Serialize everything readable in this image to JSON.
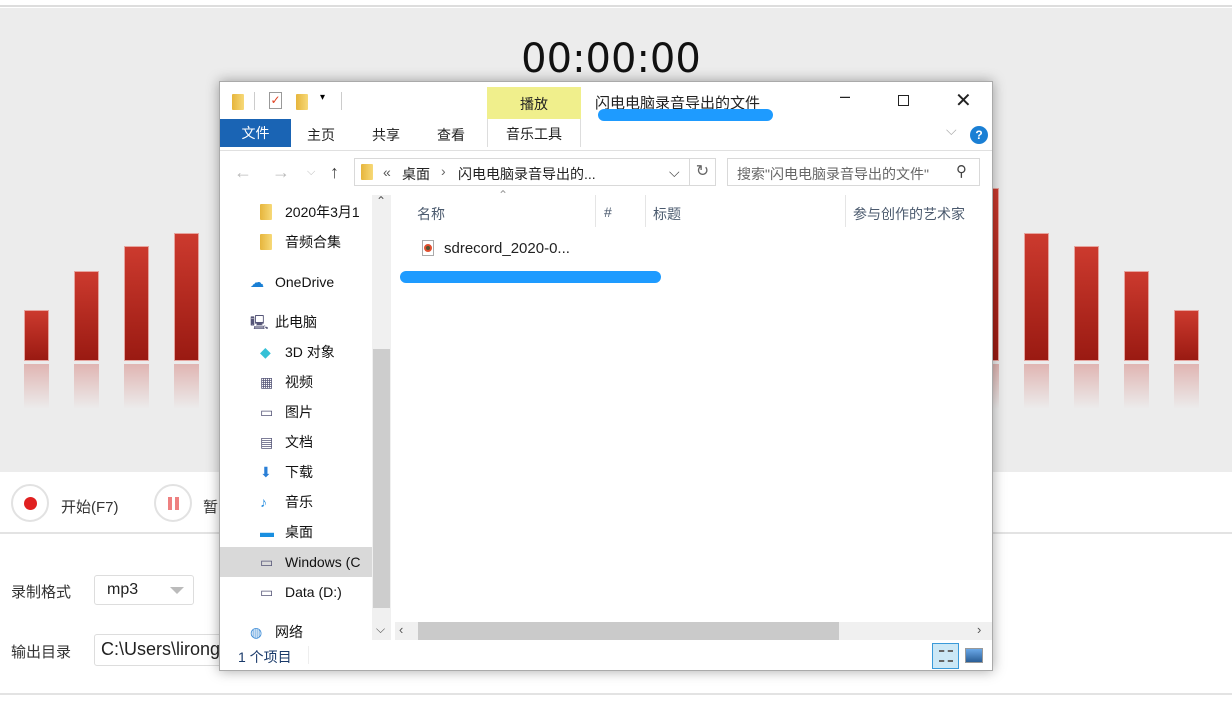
{
  "recorder": {
    "timer": "00:00:00",
    "start_label": "开始(F7)",
    "pause_label": "暂",
    "format_label": "录制格式",
    "format_value": "mp3",
    "output_label": "输出目录",
    "output_value": "C:\\Users\\lirong",
    "accent": "#c0302a"
  },
  "explorer": {
    "title": "闪电电脑录音导出的文件",
    "context_tab": "播放",
    "tabs": [
      "文件",
      "主页",
      "共享",
      "查看",
      "音乐工具"
    ],
    "breadcrumb": {
      "prefix": "«",
      "items": [
        "桌面",
        "闪电电脑录音导出的..."
      ]
    },
    "search_placeholder": "搜索\"闪电电脑录音导出的文件\"",
    "nav": [
      {
        "label": "2020年3月1",
        "icon": "folder-icon"
      },
      {
        "label": "音频合集",
        "icon": "folder-icon"
      },
      {
        "label": "OneDrive",
        "icon": "cloud-icon"
      },
      {
        "label": "此电脑",
        "icon": "computer-icon"
      },
      {
        "label": "3D 对象",
        "icon": "cube-icon"
      },
      {
        "label": "视频",
        "icon": "video-icon"
      },
      {
        "label": "图片",
        "icon": "picture-icon"
      },
      {
        "label": "文档",
        "icon": "document-icon"
      },
      {
        "label": "下载",
        "icon": "download-icon"
      },
      {
        "label": "音乐",
        "icon": "music-icon"
      },
      {
        "label": "桌面",
        "icon": "desktop-icon"
      },
      {
        "label": "Windows (C",
        "icon": "drive-icon"
      },
      {
        "label": "Data (D:)",
        "icon": "drive-icon"
      },
      {
        "label": "网络",
        "icon": "network-icon"
      }
    ],
    "columns": [
      "名称",
      "#",
      "标题",
      "参与创作的艺术家"
    ],
    "files": [
      {
        "name": "sdrecord_2020-0..."
      }
    ],
    "status": "1 个项目"
  }
}
